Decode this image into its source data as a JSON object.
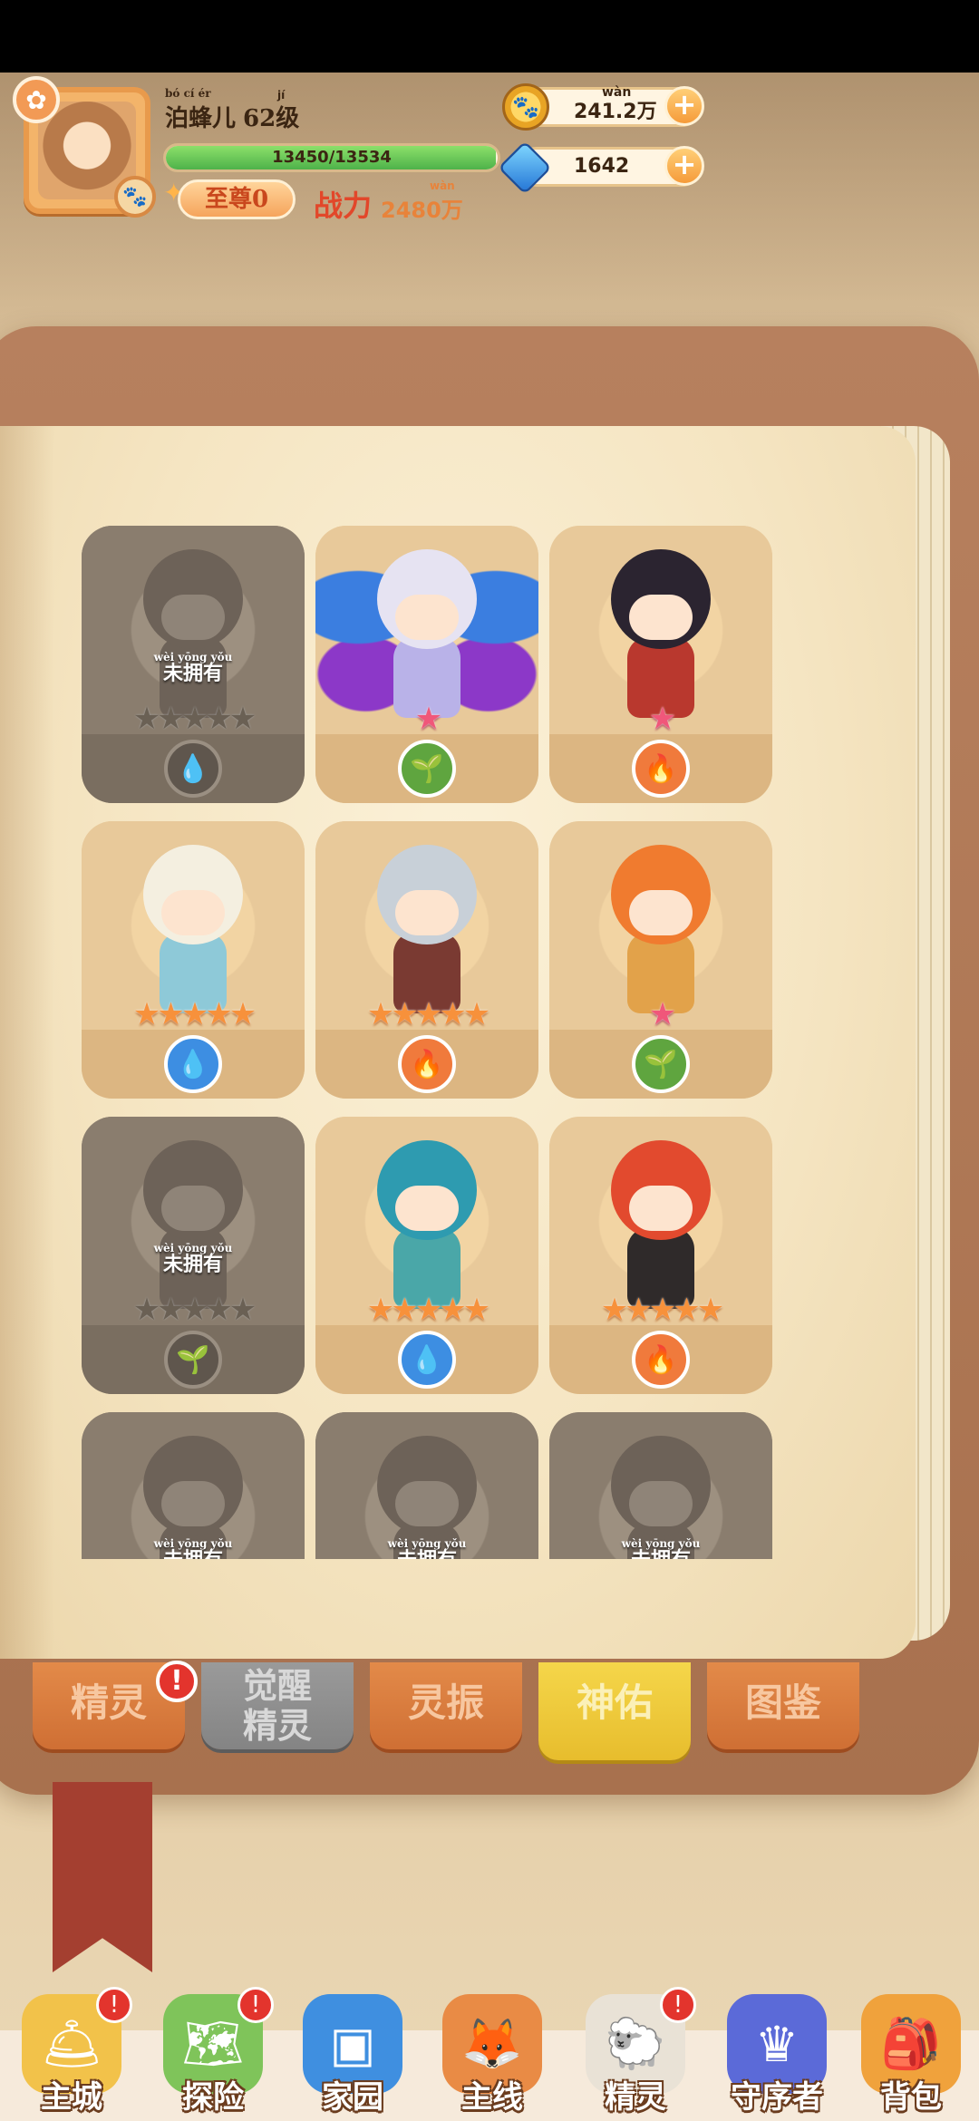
{
  "header": {
    "player_name": "泊蜂儿",
    "player_name_ruby": "bó  cí  ér",
    "level_label": "62级",
    "level_ruby": "jí",
    "xp_text": "13450/13534",
    "xp_progress": 0.9938,
    "vip_label": "至尊0",
    "power_label": "战力",
    "power_value": "2480",
    "power_unit": "万",
    "power_ruby": "wàn",
    "coins": "241.2",
    "coins_unit": "万",
    "coins_ruby": "wàn",
    "gems": "1642"
  },
  "cards": [
    {
      "name": "fox-spirit",
      "locked": true,
      "unowned_ruby": "wèi yōng yǒu",
      "unowned": "未拥有",
      "stars": "★★★★★",
      "element": "water",
      "element_glyph": "💧"
    },
    {
      "name": "butterfly-spirit",
      "locked": false,
      "stars": "★",
      "star_color": "pink",
      "element": "wood",
      "element_glyph": "🌱"
    },
    {
      "name": "dark-hair-spirit",
      "locked": false,
      "stars": "★",
      "star_color": "pink",
      "element": "fire",
      "element_glyph": "🔥"
    },
    {
      "name": "dino-hat-spirit",
      "locked": false,
      "stars": "★★★★★",
      "element": "water",
      "element_glyph": "💧"
    },
    {
      "name": "goggles-spirit",
      "locked": false,
      "stars": "★★★★★",
      "element": "fire",
      "element_glyph": "🔥"
    },
    {
      "name": "frog-hat-spirit",
      "locked": false,
      "stars": "★",
      "star_color": "pink",
      "element": "wood",
      "element_glyph": "🌱"
    },
    {
      "name": "hat-spirit",
      "locked": true,
      "unowned_ruby": "wèi yōng yǒu",
      "unowned": "未拥有",
      "stars": "★★★★★",
      "element": "wood",
      "element_glyph": "🌱"
    },
    {
      "name": "dino-hood-spirit",
      "locked": false,
      "stars": "★★★★★",
      "element": "water",
      "element_glyph": "💧"
    },
    {
      "name": "mushroom-spirit",
      "locked": false,
      "stars": "★★★★★",
      "element": "fire",
      "element_glyph": "🔥"
    },
    {
      "name": "ghost-spirit",
      "locked": true,
      "unowned_ruby": "wèi yōng yǒu",
      "unowned": "未拥有",
      "stars": "",
      "element": "",
      "element_glyph": ""
    },
    {
      "name": "horned-spirit",
      "locked": true,
      "unowned_ruby": "wèi yōng yǒu",
      "unowned": "未拥有",
      "stars": "",
      "element": "",
      "element_glyph": ""
    },
    {
      "name": "cat-spirit",
      "locked": true,
      "unowned_ruby": "wèi yōng yǒu",
      "unowned": "未拥有",
      "stars": "",
      "element": "",
      "element_glyph": ""
    }
  ],
  "tabs": [
    {
      "label": "精灵",
      "badge": "!",
      "style": "orange"
    },
    {
      "label": "觉醒\n精灵",
      "style": "gray"
    },
    {
      "label": "灵振",
      "style": "orange"
    },
    {
      "label": "神佑",
      "style": "active"
    },
    {
      "label": "图鉴",
      "style": "orange"
    }
  ],
  "bottom_nav": [
    {
      "label": "主城",
      "badge": "!",
      "icon": "bell-tower-icon",
      "color": "#f2c24a"
    },
    {
      "label": "探险",
      "badge": "!",
      "icon": "map-icon",
      "color": "#7fc45a"
    },
    {
      "label": "家园",
      "badge": "",
      "icon": "cube-house-icon",
      "color": "#3f8fe0"
    },
    {
      "label": "主线",
      "badge": "",
      "icon": "fox-icon",
      "color": "#e98b45"
    },
    {
      "label": "精灵",
      "badge": "!",
      "icon": "sheep-icon",
      "color": "#e9e2d6"
    },
    {
      "label": "守序者",
      "badge": "",
      "icon": "crowned-cat-icon",
      "color": "#5b6ad8"
    },
    {
      "label": "背包",
      "badge": "",
      "icon": "backpack-icon",
      "color": "#f0a23c"
    }
  ]
}
